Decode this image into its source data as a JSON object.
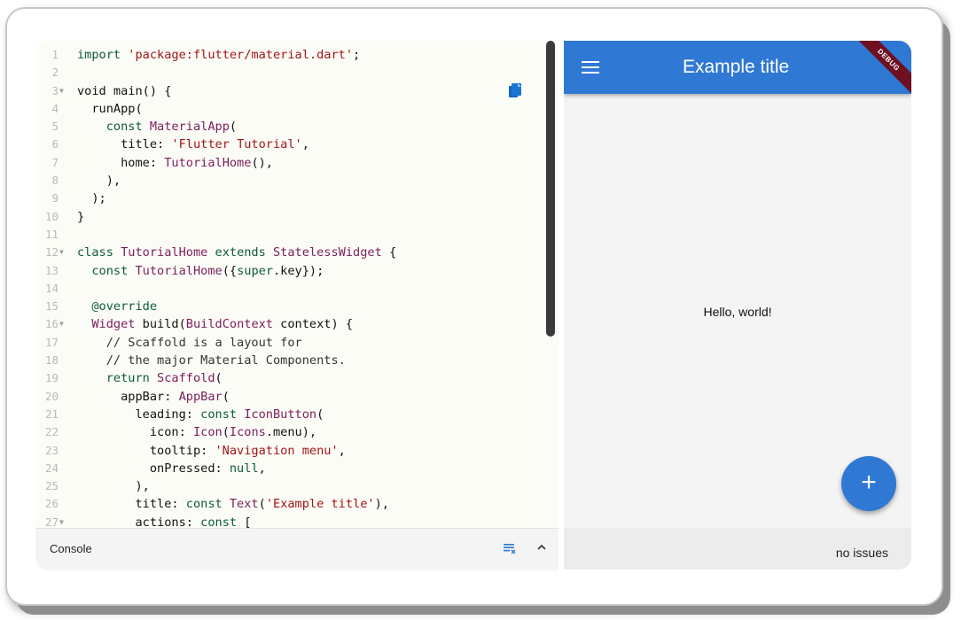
{
  "editor": {
    "lines": [
      {
        "n": "1",
        "fold": "",
        "segs": [
          [
            "kw",
            "import "
          ],
          [
            "str",
            "'package:flutter/material.dart'"
          ],
          [
            "",
            "; "
          ]
        ]
      },
      {
        "n": "2",
        "fold": "",
        "segs": []
      },
      {
        "n": "3",
        "fold": "▼",
        "segs": [
          [
            "",
            "void main() {"
          ]
        ]
      },
      {
        "n": "4",
        "fold": "",
        "segs": [
          [
            "",
            "  runApp("
          ]
        ]
      },
      {
        "n": "5",
        "fold": "",
        "segs": [
          [
            "",
            "    "
          ],
          [
            "kw",
            "const "
          ],
          [
            "ty",
            "MaterialApp"
          ],
          [
            "",
            "("
          ]
        ]
      },
      {
        "n": "6",
        "fold": "",
        "segs": [
          [
            "",
            "      title: "
          ],
          [
            "str",
            "'Flutter Tutorial'"
          ],
          [
            "",
            ","
          ]
        ]
      },
      {
        "n": "7",
        "fold": "",
        "segs": [
          [
            "",
            "      home: "
          ],
          [
            "ty",
            "TutorialHome"
          ],
          [
            "",
            "(),"
          ]
        ]
      },
      {
        "n": "8",
        "fold": "",
        "segs": [
          [
            "",
            "    ),"
          ]
        ]
      },
      {
        "n": "9",
        "fold": "",
        "segs": [
          [
            "",
            "  );"
          ]
        ]
      },
      {
        "n": "10",
        "fold": "",
        "segs": [
          [
            "",
            "}"
          ]
        ]
      },
      {
        "n": "11",
        "fold": "",
        "segs": []
      },
      {
        "n": "12",
        "fold": "▼",
        "segs": [
          [
            "kw",
            "class "
          ],
          [
            "ty",
            "TutorialHome "
          ],
          [
            "kw",
            "extends "
          ],
          [
            "ty",
            "StatelessWidget"
          ],
          [
            "",
            " {"
          ]
        ]
      },
      {
        "n": "13",
        "fold": "",
        "segs": [
          [
            "",
            "  "
          ],
          [
            "kw",
            "const "
          ],
          [
            "ty",
            "TutorialHome"
          ],
          [
            "",
            "({"
          ],
          [
            "kw",
            "super"
          ],
          [
            "",
            ".key});"
          ]
        ]
      },
      {
        "n": "14",
        "fold": "",
        "segs": []
      },
      {
        "n": "15",
        "fold": "",
        "segs": [
          [
            "",
            "  "
          ],
          [
            "kw",
            "@override"
          ]
        ]
      },
      {
        "n": "16",
        "fold": "▼",
        "segs": [
          [
            "",
            "  "
          ],
          [
            "ty",
            "Widget "
          ],
          [
            "",
            "build("
          ],
          [
            "ty",
            "BuildContext"
          ],
          [
            "",
            " context) {"
          ]
        ]
      },
      {
        "n": "17",
        "fold": "",
        "segs": [
          [
            "cm",
            "    // Scaffold is a layout for"
          ]
        ]
      },
      {
        "n": "18",
        "fold": "",
        "segs": [
          [
            "cm",
            "    // the major Material Components."
          ]
        ]
      },
      {
        "n": "19",
        "fold": "",
        "segs": [
          [
            "",
            "    "
          ],
          [
            "kw",
            "return "
          ],
          [
            "ty",
            "Scaffold"
          ],
          [
            "",
            "("
          ]
        ]
      },
      {
        "n": "20",
        "fold": "",
        "segs": [
          [
            "",
            "      appBar: "
          ],
          [
            "ty",
            "AppBar"
          ],
          [
            "",
            "("
          ]
        ]
      },
      {
        "n": "21",
        "fold": "",
        "segs": [
          [
            "",
            "        leading: "
          ],
          [
            "kw",
            "const "
          ],
          [
            "ty",
            "IconButton"
          ],
          [
            "",
            "("
          ]
        ]
      },
      {
        "n": "22",
        "fold": "",
        "segs": [
          [
            "",
            "          icon: "
          ],
          [
            "ty",
            "Icon"
          ],
          [
            "",
            "("
          ],
          [
            "ty",
            "Icons"
          ],
          [
            "",
            ".menu),"
          ]
        ]
      },
      {
        "n": "23",
        "fold": "",
        "segs": [
          [
            "",
            "          tooltip: "
          ],
          [
            "str",
            "'Navigation menu'"
          ],
          [
            "",
            ","
          ]
        ]
      },
      {
        "n": "24",
        "fold": "",
        "segs": [
          [
            "",
            "          onPressed: "
          ],
          [
            "kw",
            "null"
          ],
          [
            "",
            ","
          ]
        ]
      },
      {
        "n": "25",
        "fold": "",
        "segs": [
          [
            "",
            "        ),"
          ]
        ]
      },
      {
        "n": "26",
        "fold": "",
        "segs": [
          [
            "",
            "        title: "
          ],
          [
            "kw",
            "const "
          ],
          [
            "ty",
            "Text"
          ],
          [
            "",
            "("
          ],
          [
            "str",
            "'Example title'"
          ],
          [
            "",
            "),"
          ]
        ]
      },
      {
        "n": "27",
        "fold": "▼",
        "segs": [
          [
            "",
            "        actions: "
          ],
          [
            "kw",
            "const "
          ],
          [
            "",
            "["
          ]
        ]
      }
    ]
  },
  "console": {
    "label": "Console"
  },
  "preview": {
    "app_title": "Example title",
    "debug_banner": "DEBUG",
    "body_text": "Hello, world!",
    "fab_label": "+"
  },
  "status": {
    "text": "no issues"
  },
  "colors": {
    "appbar": "#2f78d4",
    "keyword": "#0b5a3d",
    "string": "#a31515",
    "type": "#7a1d5a"
  }
}
